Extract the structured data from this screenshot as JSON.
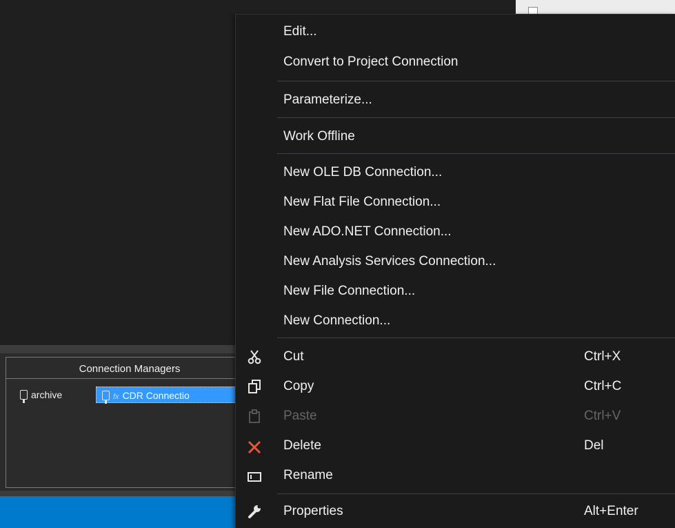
{
  "connection_managers": {
    "title": "Connection Managers",
    "items": [
      {
        "label": "archive",
        "selected": false
      },
      {
        "label": "CDR Connectio",
        "selected": true,
        "fx": "fx"
      }
    ]
  },
  "context_menu": {
    "items": [
      {
        "label": "Edit..."
      },
      {
        "label": "Convert to Project Connection"
      },
      {
        "label": "Parameterize..."
      },
      {
        "label": "Work Offline"
      },
      {
        "label": "New OLE DB Connection..."
      },
      {
        "label": "New Flat File Connection..."
      },
      {
        "label": "New ADO.NET Connection..."
      },
      {
        "label": "New Analysis Services Connection..."
      },
      {
        "label": "New File Connection..."
      },
      {
        "label": "New Connection..."
      },
      {
        "label": "Cut",
        "shortcut": "Ctrl+X",
        "icon": "scissors-icon"
      },
      {
        "label": "Copy",
        "shortcut": "Ctrl+C",
        "icon": "copy-icon"
      },
      {
        "label": "Paste",
        "shortcut": "Ctrl+V",
        "icon": "paste-icon",
        "disabled": true
      },
      {
        "label": "Delete",
        "shortcut": "Del",
        "icon": "delete-x-icon"
      },
      {
        "label": "Rename",
        "icon": "rename-icon"
      },
      {
        "label": "Properties",
        "shortcut": "Alt+Enter",
        "icon": "wrench-icon"
      }
    ]
  },
  "colors": {
    "menu_bg": "#1b1b1c",
    "selection": "#3399ff",
    "status_bar": "#007acc",
    "delete_icon": "#e8563a",
    "disabled_text": "#656565"
  }
}
